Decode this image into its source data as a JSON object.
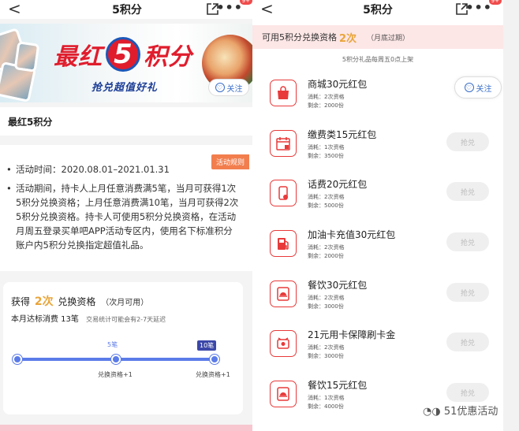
{
  "left": {
    "nav": {
      "back": "<",
      "title": "5积分",
      "more": "•••",
      "badge": "9+"
    },
    "banner": {
      "title_a": "最红",
      "title_five": "5",
      "title_b": "积分",
      "subtitle": "抢兑超值好礼",
      "follow": "关注"
    },
    "activity_name": "最红5积分",
    "rules_tag": "活动规则",
    "rules": [
      {
        "bullet": "•",
        "text": "活动时间：2020.08.01–2021.01.31"
      },
      {
        "bullet": "•",
        "text": "活动期间，持卡人上月任意消费满5笔，当月可获得1次5积分兑换资格；上月任意消费满10笔，当月可获得2次5积分兑换资格。持卡人可使用5积分兑换资格，在活动月周五登录买单吧APP活动专区内，使用名下标准积分账户内5积分兑换指定超值礼品。"
      }
    ],
    "progress": {
      "label_pre": "获得",
      "count": "2次",
      "label_post": "兑换资格",
      "paren": "（次月可用）",
      "stat": "本月达标消费 13笔",
      "note": "交易统计可能会有2-7天延迟",
      "marker_5": "5笔",
      "marker_10": "10笔",
      "under_5": "兑换资格+1",
      "under_10": "兑换资格+1",
      "level_fraction": 1.0
    }
  },
  "right": {
    "nav": {
      "back": "<",
      "title": "5积分",
      "more": "•••",
      "badge": "9+"
    },
    "available": {
      "pre": "可用5积分兑换资格",
      "count": "2次",
      "expiry": "（月底过期）"
    },
    "shelf_note": "5积分礼品每周五0点上架",
    "follow": "关注",
    "items": [
      {
        "title": "商城30元红包",
        "cost": "消耗：2次资格",
        "left": "剩余：2000份",
        "button": "",
        "icon": "bag-icon"
      },
      {
        "title": "缴费类15元红包",
        "cost": "消耗：1次资格",
        "left": "剩余：3500份",
        "button": "抢兑",
        "icon": "calendar-icon"
      },
      {
        "title": "话费20元红包",
        "cost": "消耗：2次资格",
        "left": "剩余：5000份",
        "button": "抢兑",
        "icon": "phone-icon"
      },
      {
        "title": "加油卡充值30元红包",
        "cost": "消耗：2次资格",
        "left": "剩余：2000份",
        "button": "抢兑",
        "icon": "fuel-icon"
      },
      {
        "title": "餐饮30元红包",
        "cost": "消耗：2次资格",
        "left": "剩余：3000份",
        "button": "抢兑",
        "icon": "dining-icon"
      },
      {
        "title": "21元用卡保障刷卡金",
        "cost": "消耗：2次资格",
        "left": "剩余：3000份",
        "button": "抢兑",
        "icon": "alarm-icon"
      },
      {
        "title": "餐饮15元红包",
        "cost": "消耗：1次资格",
        "left": "剩余：4000份",
        "button": "抢兑",
        "icon": "dining-icon"
      }
    ]
  },
  "watermark": "51优惠活动"
}
